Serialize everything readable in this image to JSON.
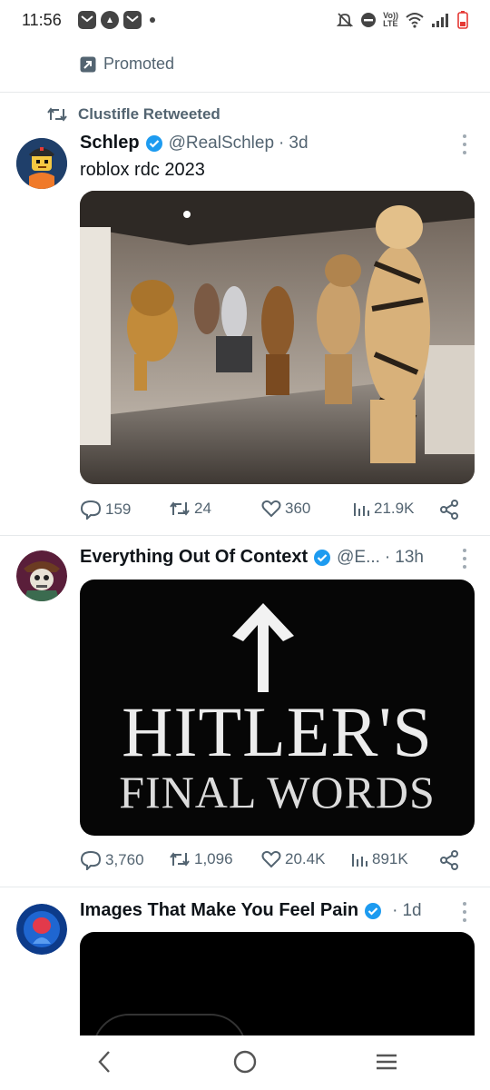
{
  "status_bar": {
    "time": "11:56",
    "volte": "Vo))",
    "lte": "LTE"
  },
  "promoted": {
    "label": "Promoted"
  },
  "tweets": [
    {
      "context": "Clustifle Retweeted",
      "name": "Schlep",
      "verified": true,
      "handle": "@RealSchlep",
      "sep": "·",
      "ago": "3d",
      "text": "roblox rdc 2023",
      "stats": {
        "replies": "159",
        "retweets": "24",
        "likes": "360",
        "views": "21.9K"
      }
    },
    {
      "name": "Everything Out Of Context",
      "verified": true,
      "handle": "@E...",
      "sep": "·",
      "ago": "13h",
      "image_text": {
        "line1": "HITLER'S",
        "line2": "FINAL WORDS"
      },
      "stats": {
        "replies": "3,760",
        "retweets": "1,096",
        "likes": "20.4K",
        "views": "891K"
      }
    },
    {
      "name": "Images That Make You Feel Pain",
      "verified": true,
      "sep": "·",
      "ago": "1d"
    }
  ],
  "colors": {
    "verified_blue": "#1d9bf0",
    "secondary_text": "#536471",
    "battery_red": "#e53935"
  }
}
